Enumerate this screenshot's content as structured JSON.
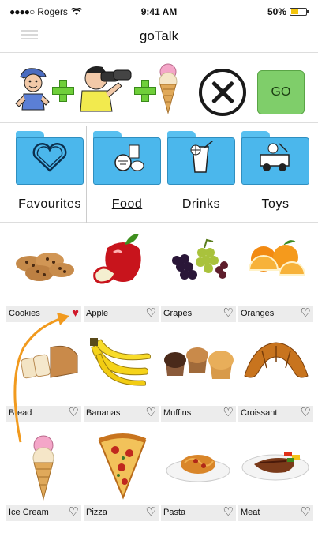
{
  "status_bar": {
    "carrier": "Rogers",
    "time": "9:41 AM",
    "battery": "50%",
    "battery_level": 0.5
  },
  "nav": {
    "title": "goTalk"
  },
  "sentence_strip": {
    "symbols": [
      "boy-icon",
      "looking-binoculars-icon",
      "ice-cream-icon"
    ],
    "clear_icon": "close-circle-icon",
    "go_label": "GO",
    "go_color": "#7fce6a"
  },
  "categories": [
    {
      "label": "Favourites",
      "icon": "heart-folder-icon",
      "active": false
    },
    {
      "label": "Food",
      "icon": "food-folder-icon",
      "active": true
    },
    {
      "label": "Drinks",
      "icon": "drink-folder-icon",
      "active": false
    },
    {
      "label": "Toys",
      "icon": "toys-folder-icon",
      "active": false
    }
  ],
  "items": [
    {
      "name": "Cookies",
      "favourite": true
    },
    {
      "name": "Apple",
      "favourite": false
    },
    {
      "name": "Grapes",
      "favourite": false
    },
    {
      "name": "Oranges",
      "favourite": false
    },
    {
      "name": "Bread",
      "favourite": false
    },
    {
      "name": "Bananas",
      "favourite": false
    },
    {
      "name": "Muffins",
      "favourite": false
    },
    {
      "name": "Croissant",
      "favourite": false
    },
    {
      "name": "Ice Cream",
      "favourite": false
    },
    {
      "name": "Pizza",
      "favourite": false
    },
    {
      "name": "Pasta",
      "favourite": false
    },
    {
      "name": "Meat",
      "favourite": false
    }
  ],
  "colors": {
    "folder_blue": "#4bb7ec",
    "favourite_heart": "#d0182a",
    "arrow": "#f19a1e",
    "plus_green": "#6fcf3a"
  }
}
